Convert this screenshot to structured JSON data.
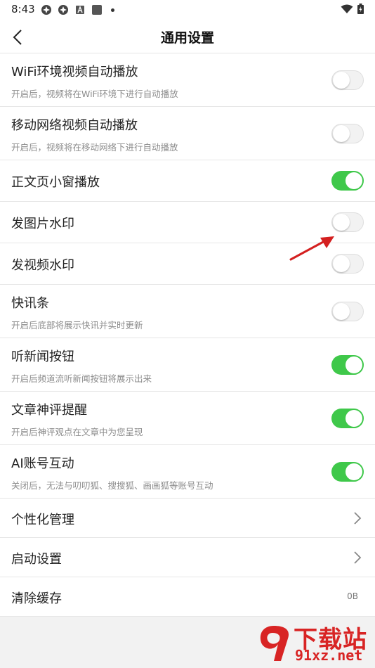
{
  "status_bar": {
    "time": "8:43"
  },
  "header": {
    "title": "通用设置"
  },
  "settings": [
    {
      "label": "WiFi环境视频自动播放",
      "desc": "开启后，视频将在WiFi环境下进行自动播放",
      "enabled": false
    },
    {
      "label": "移动网络视频自动播放",
      "desc": "开启后，视频将在移动网络下进行自动播放",
      "enabled": false
    },
    {
      "label": "正文页小窗播放",
      "enabled": true
    },
    {
      "label": "发图片水印",
      "enabled": false
    },
    {
      "label": "发视频水印",
      "enabled": false
    },
    {
      "label": "快讯条",
      "desc": "开启后底部将展示快讯并实时更新",
      "enabled": false
    },
    {
      "label": "听新闻按钮",
      "desc": "开启后频道流听新闻按钮将展示出来",
      "enabled": true
    },
    {
      "label": "文章神评提醒",
      "desc": "开启后神评观点在文章中为您呈现",
      "enabled": true
    },
    {
      "label": "AI账号互动",
      "desc": "关闭后，无法与叨叨狐、搜搜狐、画画狐等账号互动",
      "enabled": true
    }
  ],
  "nav_items": [
    {
      "label": "个性化管理"
    },
    {
      "label": "启动设置"
    }
  ],
  "cache": {
    "label": "清除缓存",
    "value": "0B"
  },
  "watermark": {
    "brand": "下载站",
    "url": "91xz.net"
  },
  "colors": {
    "toggle_on": "#3fc84a",
    "toggle_off": "#f2f2f2",
    "annotation_arrow": "#d42020"
  }
}
